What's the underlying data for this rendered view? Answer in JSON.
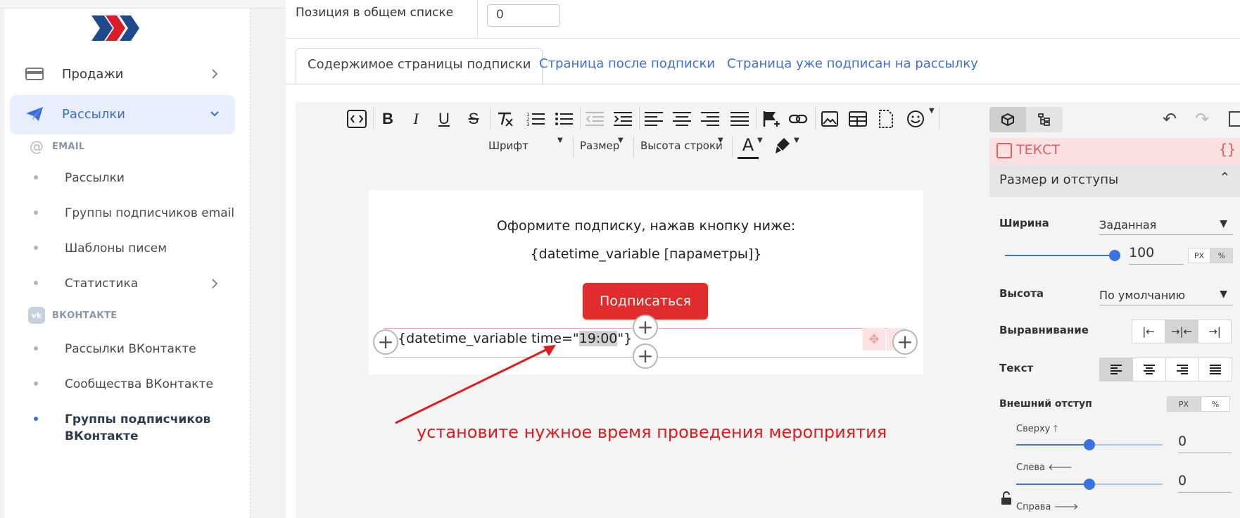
{
  "sidebar": {
    "items": [
      {
        "label": "Продажи",
        "icon": "wallet-card-icon"
      },
      {
        "label": "Рассылки",
        "icon": "paper-plane-icon"
      }
    ],
    "email_section": "EMAIL",
    "email_items": [
      "Рассылки",
      "Группы подписчиков email",
      "Шаблоны писем",
      "Статистика"
    ],
    "vk_section": "ВКОНТАКТЕ",
    "vk_items": [
      "Рассылки ВКонтакте",
      "Сообщества ВКонтакте",
      "Группы подписчиков ВКонтакте"
    ],
    "vk_item_3_line1": "Группы подписчиков",
    "vk_item_3_line2": "ВКонтакте"
  },
  "header": {
    "position_label": "Позиция в общем списке",
    "position_value": "0"
  },
  "tabs": [
    {
      "label": "Содержимое страницы подписки",
      "active": true
    },
    {
      "label": "Страница после подписки",
      "active": false
    },
    {
      "label": "Страница уже подписан на рассылку",
      "active": false
    }
  ],
  "toolbar": {
    "font_label": "Шрифт",
    "size_label": "Размер",
    "line_height_label": "Высота строки",
    "font_color_glyph": "A"
  },
  "canvas": {
    "line1": "Оформите подписку, нажав кнопку ниже:",
    "line2": "{datetime_variable [параметры]}",
    "button_label": "Подписаться",
    "selected_prefix": "{datetime_variable time=\"",
    "selected_highlight": "19:00",
    "selected_suffix": "\"}"
  },
  "annotation": "установите нужное время проведения мероприятия",
  "panel": {
    "block_title": "ТЕКСТ",
    "block_code": "{}",
    "section_title": "Размер и отступы",
    "width_label": "Ширина",
    "width_mode": "Заданная",
    "width_value": "100",
    "width_unit_px": "PX",
    "width_unit_pct": "%",
    "width_slider_fraction": 1.0,
    "height_label": "Высота",
    "height_mode": "По умолчанию",
    "align_label": "Выравнивание",
    "text_label": "Текст",
    "outer_margin_label": "Внешний отступ",
    "margin_unit_px": "PX",
    "margin_unit_pct": "%",
    "top_label": "Сверху",
    "top_value": "0",
    "left_label": "Слева",
    "left_value": "0",
    "right_label": "Справа",
    "margin_slider_fraction": 0.5
  },
  "colors": {
    "accent": "#3a6fd8",
    "button": "#e02c2c",
    "annotation": "#e01b1b"
  }
}
